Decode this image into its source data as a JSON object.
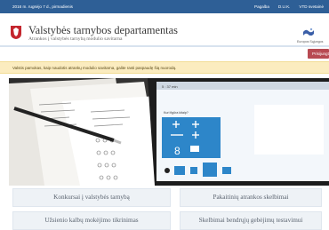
{
  "topbar": {
    "date": "2016 m. rugsėjo 7 d., pirmadienis",
    "links": [
      "Pagalba",
      "D.U.K.",
      "VTD svetainė"
    ]
  },
  "header": {
    "title": "Valstybės tarnybos departamentas",
    "subtitle": "Atrankos į valstybės tarnybą modulio savitarna",
    "logo_caption": "Europos Sąjungos"
  },
  "login_button": "Prisijungti",
  "notice": "Valstis pamokas, kaip naudotis atrankų modulio savitarna, galite rasti paspaudę šią nuorodą.",
  "hero": {
    "screen_time": "5 : 37 min",
    "screen_caption": "Kuri figūra kitaip?"
  },
  "nav": {
    "buttons": [
      "Konkursai į valstybės tarnybą",
      "Pakaitinių atrankos skelbimai",
      "Užsienio kalbų mokėjimo tikrinimas",
      "Skelbimai bendrųjų gebėjimų testavimui"
    ]
  },
  "colors": {
    "topbar": "#2e5f96",
    "notice": "#fbecbf",
    "login": "#b84a52",
    "nav": "#eef2f6"
  }
}
